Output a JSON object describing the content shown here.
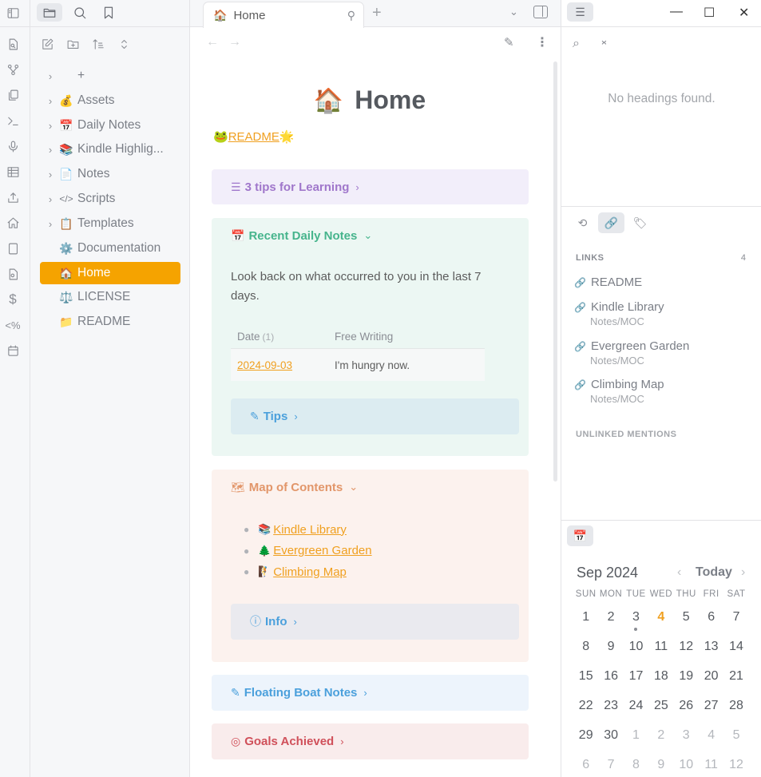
{
  "ribbon": {
    "icons": [
      "sidebar-toggle-icon",
      "quick-switcher-icon",
      "graph-icon",
      "copy-icon",
      "terminal-icon",
      "microphone-icon",
      "table-icon",
      "upload-icon",
      "home-icon",
      "tablet-icon",
      "file-search-icon",
      "dollar-icon",
      "template-icon",
      "calendar-icon"
    ],
    "template_glyph": "<%",
    "dollar_glyph": "$"
  },
  "explorer": {
    "tabs": [
      "files",
      "search",
      "bookmarks"
    ],
    "active_tab": "files",
    "items": [
      {
        "label": "+",
        "emoji": "",
        "folder": true
      },
      {
        "label": "Assets",
        "emoji": "💰",
        "folder": true
      },
      {
        "label": "Daily Notes",
        "emoji": "📅",
        "folder": true
      },
      {
        "label": "Kindle Highlig...",
        "emoji": "📚",
        "folder": true
      },
      {
        "label": "Notes",
        "emoji": "📄",
        "folder": true
      },
      {
        "label": "Scripts",
        "emoji": "</>",
        "folder": true
      },
      {
        "label": "Templates",
        "emoji": "📋",
        "folder": true
      },
      {
        "label": "Documentation",
        "emoji": "⚙️",
        "folder": false
      },
      {
        "label": "Home",
        "emoji": "🏠",
        "folder": false,
        "active": true
      },
      {
        "label": "LICENSE",
        "emoji": "⚖️",
        "folder": false
      },
      {
        "label": "README",
        "emoji": "📁",
        "folder": false
      }
    ]
  },
  "tabbar": {
    "tab_title": "Home",
    "tab_emoji": "🏠",
    "pin_glyph": "⚲",
    "new_tab": "+",
    "dropdown": "⌄"
  },
  "viewhead": {
    "back": "←",
    "forward": "→",
    "edit": "✎",
    "more": "⋮"
  },
  "main": {
    "title": "Home",
    "title_emoji": "🏠",
    "readme_prefix": "🐸",
    "readme_link": "README",
    "readme_suffix": "🌟",
    "callouts": {
      "learning": {
        "icon": "☰",
        "title": "3 tips for Learning",
        "arrow": "›"
      },
      "daily": {
        "icon": "📅",
        "title": "Recent Daily Notes",
        "arrow": "⌄",
        "description": "Look back on what occurred to you in the last 7 days.",
        "table": {
          "headers": [
            "Date",
            "Free Writing"
          ],
          "count": "(1)",
          "rows": [
            [
              "2024-09-03",
              "I'm hungry now."
            ]
          ]
        },
        "tips": {
          "icon": "✎",
          "title": "Tips",
          "arrow": "›"
        }
      },
      "map": {
        "icon": "🗺",
        "title": "Map of Contents",
        "arrow": "⌄",
        "items": [
          {
            "emoji": "📚",
            "label": "Kindle Library"
          },
          {
            "emoji": "🌲",
            "label": "Evergreen Garden"
          },
          {
            "emoji": "🧗",
            "label": "Climbing Map"
          }
        ],
        "info": {
          "icon": "ⓘ",
          "title": "Info",
          "arrow": "›"
        }
      },
      "floating": {
        "icon": "✎",
        "title": "Floating Boat Notes",
        "arrow": "›"
      },
      "goals": {
        "icon": "◎",
        "title": "Goals Achieved",
        "arrow": "›"
      }
    }
  },
  "right": {
    "outline_btn": "☰",
    "window": {
      "minimize": "—",
      "maximize": "☐",
      "close": "✕"
    },
    "search": "⌕",
    "collapse": "⌃⌄",
    "no_headings": "No headings found.",
    "tabs": [
      "backlinks",
      "outgoing-links",
      "tags"
    ],
    "links_label": "LINKS",
    "links_count": "4",
    "links": [
      {
        "title": "README",
        "path": ""
      },
      {
        "title": "Kindle Library",
        "path": "Notes/MOC"
      },
      {
        "title": "Evergreen Garden",
        "path": "Notes/MOC"
      },
      {
        "title": "Climbing Map",
        "path": "Notes/MOC"
      }
    ],
    "link_glyph": "🔗",
    "unlinked_label": "UNLINKED MENTIONS",
    "calendar": {
      "month": "Sep 2024",
      "today": "Today",
      "prev": "‹",
      "next": "›",
      "dow": [
        "SUN",
        "MON",
        "TUE",
        "WED",
        "THU",
        "FRI",
        "SAT"
      ],
      "weeks": [
        [
          "1",
          "2",
          "3",
          "4",
          "5",
          "6",
          "7"
        ],
        [
          "8",
          "9",
          "10",
          "11",
          "12",
          "13",
          "14"
        ],
        [
          "15",
          "16",
          "17",
          "18",
          "19",
          "20",
          "21"
        ],
        [
          "22",
          "23",
          "24",
          "25",
          "26",
          "27",
          "28"
        ],
        [
          "29",
          "30",
          "1",
          "2",
          "3",
          "4",
          "5"
        ],
        [
          "6",
          "7",
          "8",
          "9",
          "10",
          "11",
          "12"
        ]
      ],
      "today_date": "4",
      "dot_date": "3",
      "other_month_start_week": 4,
      "other_month_start_col": 2
    }
  }
}
